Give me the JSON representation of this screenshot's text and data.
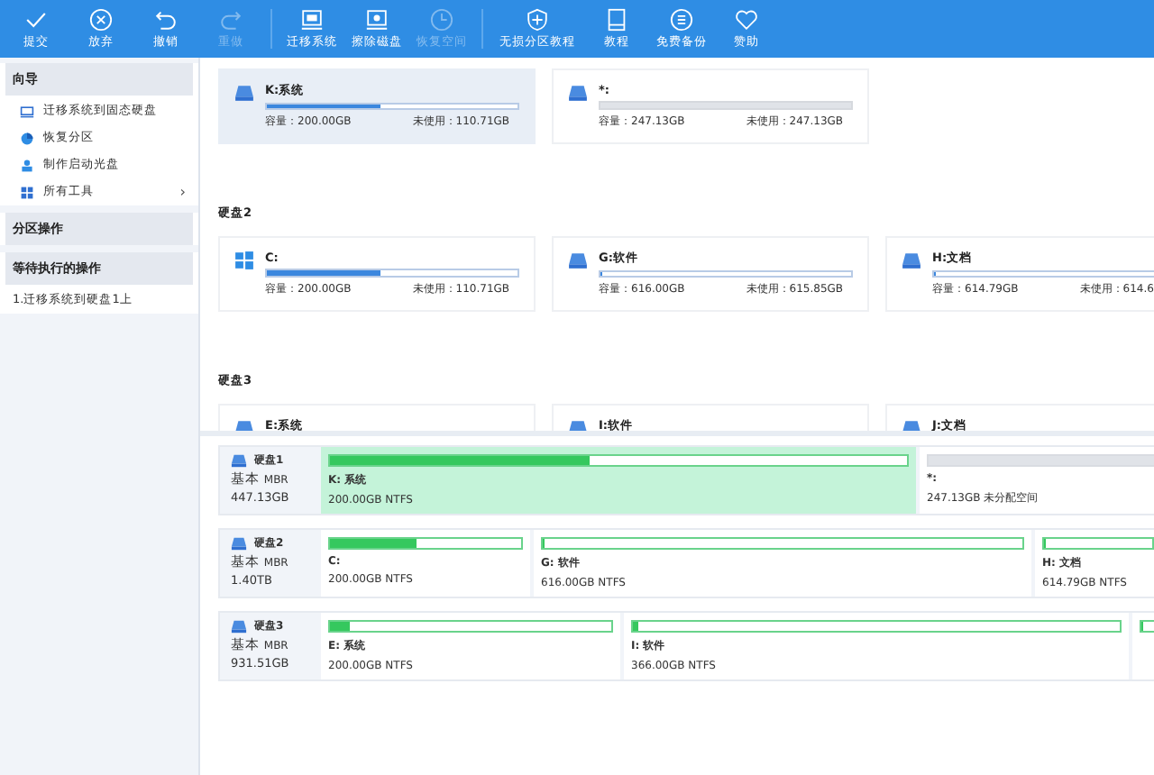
{
  "toolbar": [
    {
      "label": "提交",
      "disabled": false
    },
    {
      "label": "放弃",
      "disabled": false
    },
    {
      "label": "撤销",
      "disabled": false
    },
    {
      "label": "重做",
      "disabled": true
    },
    {
      "label": "迁移系统",
      "disabled": false
    },
    {
      "label": "擦除磁盘",
      "disabled": false
    },
    {
      "label": "恢复空间",
      "disabled": true
    },
    {
      "label": "无损分区教程",
      "disabled": false
    },
    {
      "label": "教程",
      "disabled": false
    },
    {
      "label": "免费备份",
      "disabled": false
    },
    {
      "label": "赞助",
      "disabled": false
    }
  ],
  "sidebar": {
    "sections": [
      {
        "title": "向导",
        "items": [
          {
            "label": "迁移系统到固态硬盘"
          },
          {
            "label": "恢复分区"
          },
          {
            "label": "制作启动光盘"
          },
          {
            "label": "所有工具",
            "arrow": "›"
          }
        ]
      },
      {
        "title": "分区操作"
      },
      {
        "title": "等待执行的操作",
        "items": [
          {
            "label": "1.迁移系统到硬盘1上"
          }
        ]
      }
    ]
  },
  "disk_cards": [
    {
      "cards": [
        {
          "kind": "partition",
          "selected": true,
          "name": "K:系统",
          "level": 0.45,
          "capacity": "容量：200.00GB",
          "free": "未使用：110.71GB"
        },
        {
          "kind": "unallocated",
          "selected": false,
          "name": "*:",
          "capacity": "容量：247.13GB",
          "free": "未使用：247.13GB"
        }
      ]
    },
    {
      "heading": "硬盘2",
      "cards": [
        {
          "kind": "system",
          "selected": false,
          "name": "C:",
          "level": 0.45,
          "capacity": "容量：200.00GB",
          "free": "未使用：110.71GB"
        },
        {
          "kind": "partition",
          "selected": false,
          "name": "G:软件",
          "level": 0.01,
          "capacity": "容量：616.00GB",
          "free": "未使用：615.85GB"
        },
        {
          "kind": "partition",
          "selected": false,
          "name": "H:文档",
          "level": 0.01,
          "capacity": "容量：614.79GB",
          "free": "未使用：614.6"
        }
      ]
    },
    {
      "heading": "硬盘3",
      "cards": [
        {
          "kind": "partition",
          "selected": false,
          "name": "E:系统"
        },
        {
          "kind": "partition",
          "selected": false,
          "name": "I:软件"
        },
        {
          "kind": "partition",
          "selected": false,
          "name": "J:文档"
        }
      ]
    }
  ],
  "disk_map": [
    {
      "name": "硬盘1",
      "type": "基本",
      "style": "MBR",
      "size": "447.13GB",
      "partitions": [
        {
          "kind": "partition",
          "selected": true,
          "name": "K: 系统",
          "info": "200.00GB NTFS",
          "level": 0.45
        },
        {
          "kind": "unallocated",
          "selected": false,
          "name": "*:",
          "info": "247.13GB 未分配空间"
        }
      ]
    },
    {
      "name": "硬盘2",
      "type": "基本",
      "style": "MBR",
      "size": "1.40TB",
      "partitions": [
        {
          "kind": "partition",
          "selected": false,
          "name": "C:",
          "info": "200.00GB NTFS",
          "level": 0.45
        },
        {
          "kind": "partition",
          "selected": false,
          "name": "G: 软件",
          "info": "616.00GB NTFS",
          "level": 0.005
        },
        {
          "kind": "partition",
          "selected": false,
          "name": "H: 文档",
          "info": "614.79GB NTFS",
          "level": 0.005
        }
      ]
    },
    {
      "name": "硬盘3",
      "type": "基本",
      "style": "MBR",
      "size": "931.51GB",
      "partitions": [
        {
          "kind": "partition",
          "selected": false,
          "name": "E: 系统",
          "info": "200.00GB NTFS",
          "level": 0.07
        },
        {
          "kind": "partition",
          "selected": false,
          "name": "I: 软件",
          "info": "366.00GB NTFS",
          "level": 0.01
        },
        {
          "kind": "partition",
          "selected": false,
          "level": 0.005
        }
      ]
    }
  ]
}
